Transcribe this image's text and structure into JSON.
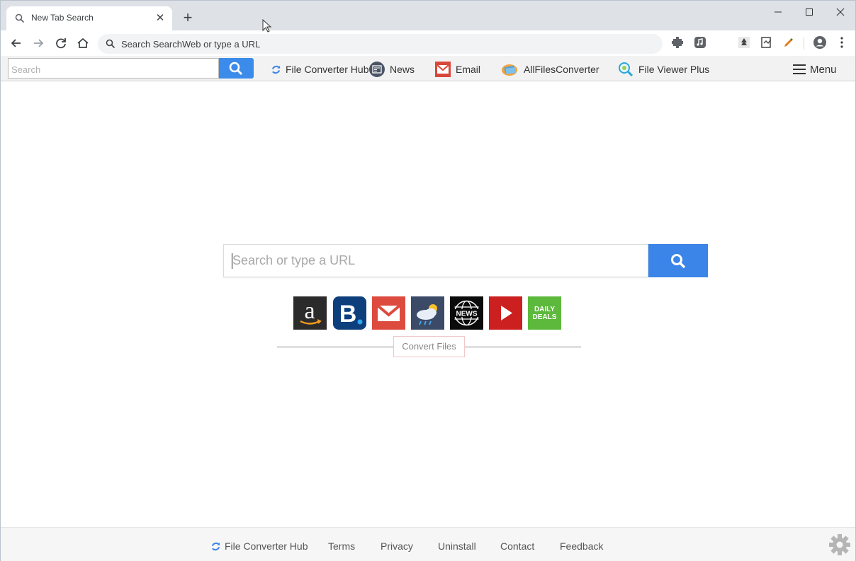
{
  "browser": {
    "tab": {
      "title": "New Tab Search",
      "close_glyph": "✕"
    },
    "new_tab_glyph": "+",
    "omnibox": {
      "text": "Search SearchWeb or type a URL"
    }
  },
  "extension_bar": {
    "search_placeholder": "Search",
    "links": [
      {
        "label": "File Converter Hub",
        "icon": "refresh-icon"
      },
      {
        "label": "News",
        "icon": "news-icon"
      },
      {
        "label": "Email",
        "icon": "email-icon"
      },
      {
        "label": "AllFilesConverter",
        "icon": "files-icon"
      },
      {
        "label": "File Viewer Plus",
        "icon": "magnifier-icon"
      }
    ],
    "menu_label": "Menu"
  },
  "main": {
    "search_placeholder": "Search or type a URL",
    "tiles": [
      {
        "name": "amazon",
        "glyph": "a",
        "color": "#2f2f2f"
      },
      {
        "name": "booking",
        "glyph": "B",
        "color": "#0e3f7d"
      },
      {
        "name": "gmail",
        "glyph": "",
        "color": "#dd4b3e"
      },
      {
        "name": "weather",
        "glyph": "",
        "color": "#3b4a66"
      },
      {
        "name": "news",
        "glyph": "NEWS",
        "color": "#0b0b0b"
      },
      {
        "name": "youtube",
        "glyph": "",
        "color": "#cc1f1f"
      },
      {
        "name": "daily-deals",
        "glyph": "DAILY DEALS",
        "color": "#5cb93c"
      }
    ],
    "convert_button": "Convert Files"
  },
  "footer": {
    "brand": "File Converter Hub",
    "links": [
      "Terms",
      "Privacy",
      "Uninstall",
      "Contact",
      "Feedback"
    ]
  },
  "colors": {
    "accent": "#3b85e8",
    "tabstrip": "#dee1e6"
  }
}
